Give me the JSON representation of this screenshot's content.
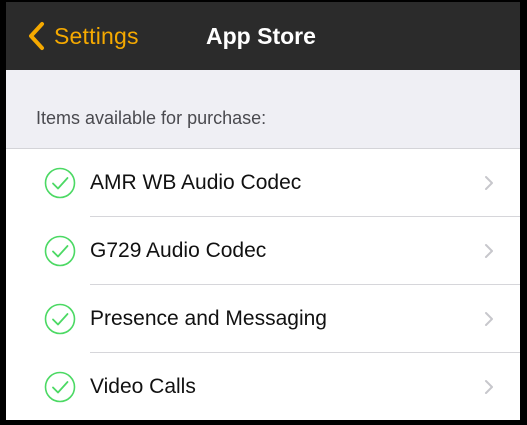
{
  "navbar": {
    "back_label": "Settings",
    "back_icon": "chevron-left-icon",
    "title": "App Store",
    "accent_color": "#f5a900",
    "background_color": "#2b2b2b"
  },
  "section": {
    "header": "Items available for purchase:"
  },
  "items": [
    {
      "label": "AMR WB Audio Codec",
      "status_icon": "check-circle-icon",
      "accessory_icon": "chevron-right-icon"
    },
    {
      "label": "G729 Audio Codec",
      "status_icon": "check-circle-icon",
      "accessory_icon": "chevron-right-icon"
    },
    {
      "label": "Presence and Messaging",
      "status_icon": "check-circle-icon",
      "accessory_icon": "chevron-right-icon"
    },
    {
      "label": "Video Calls",
      "status_icon": "check-circle-icon",
      "accessory_icon": "chevron-right-icon"
    }
  ],
  "colors": {
    "check": "#4cd964",
    "disclosure": "#c7c7cc",
    "background": "#efeff4"
  }
}
